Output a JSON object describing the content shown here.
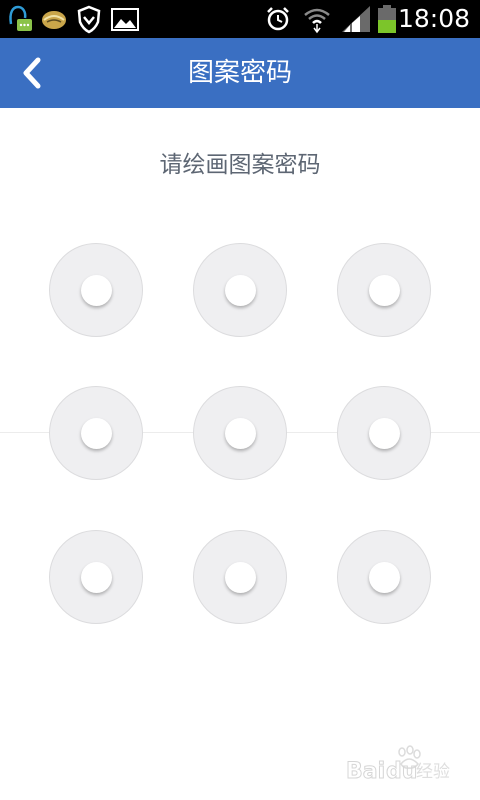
{
  "status_bar": {
    "time": "18:08",
    "icons": [
      "qq-notification-icon",
      "taco-app-icon",
      "shield-icon",
      "picture-icon",
      "alarm-clock-icon",
      "wifi-icon",
      "cell-signal-icon",
      "battery-icon"
    ]
  },
  "title_bar": {
    "title": "图案密码",
    "back_icon": "chevron-left-icon",
    "background_color": "#3a6fc2"
  },
  "content": {
    "prompt": "请绘画图案密码",
    "pattern_nodes": [
      {
        "row": 1,
        "col": 1
      },
      {
        "row": 1,
        "col": 2
      },
      {
        "row": 1,
        "col": 3
      },
      {
        "row": 2,
        "col": 1
      },
      {
        "row": 2,
        "col": 2
      },
      {
        "row": 2,
        "col": 3
      },
      {
        "row": 3,
        "col": 1
      },
      {
        "row": 3,
        "col": 2
      },
      {
        "row": 3,
        "col": 3
      }
    ]
  },
  "watermark": {
    "text": "Baidu经验",
    "icon": "baidu-paw-icon"
  }
}
